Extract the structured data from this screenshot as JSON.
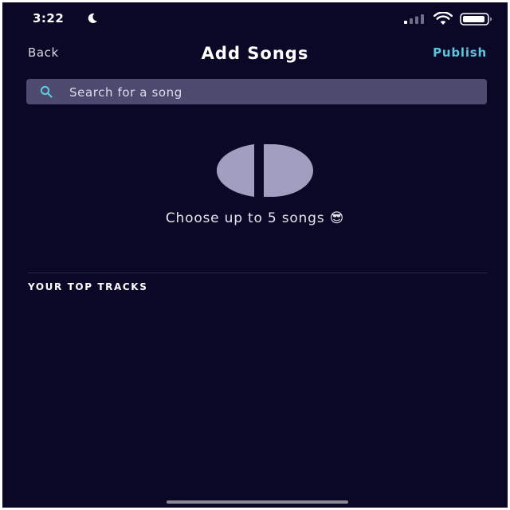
{
  "status_bar": {
    "time": "3:22",
    "icons": [
      "moon-icon",
      "signal-icon",
      "wifi-icon",
      "battery-icon"
    ]
  },
  "nav": {
    "back_label": "Back",
    "title": "Add Songs",
    "publish_label": "Publish"
  },
  "search": {
    "placeholder": "Search for a song",
    "value": ""
  },
  "empty_state": {
    "text": "Choose up to 5 songs 😎"
  },
  "top_tracks": {
    "title": "YOUR TOP TRACKS",
    "items": []
  },
  "colors": {
    "background": "#0b0827",
    "accent": "#59c8dc",
    "search_field": "#4c4b6f",
    "logo": "#a09fbf"
  }
}
